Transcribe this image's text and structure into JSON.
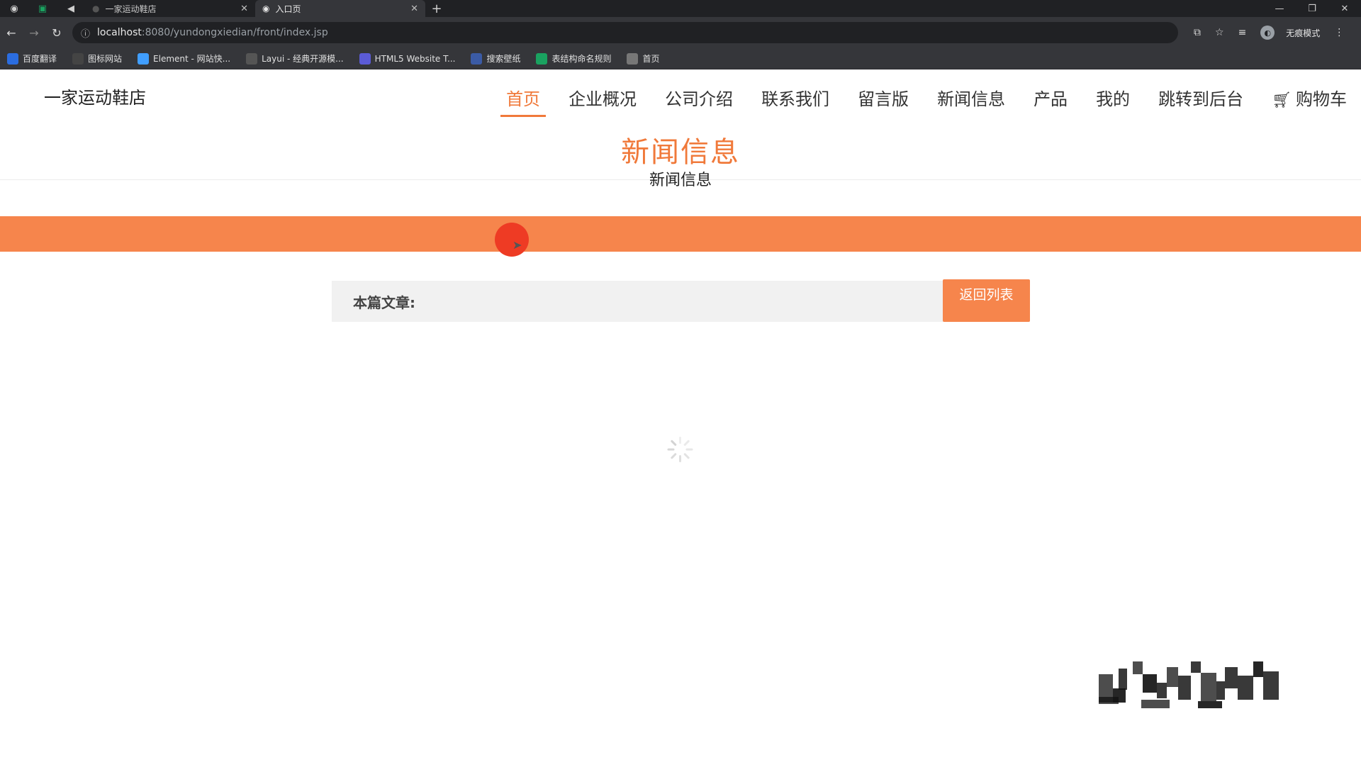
{
  "browser": {
    "tabs": [
      {
        "title": "一家运动鞋店",
        "close": "✕"
      },
      {
        "title": "入口页",
        "close": "✕"
      }
    ],
    "new_tab": "+",
    "window_controls": [
      "—",
      "❐",
      "✕"
    ],
    "url_host": "localhost",
    "url_path": ":8080/yundongxiedian/front/index.jsp",
    "profile_label": "无痕模式",
    "bookmarks": [
      {
        "label": "百度翻译",
        "icon": "translate-icon",
        "color": "#2b6de0"
      },
      {
        "label": "图标网站",
        "icon": "flag-icon",
        "color": "#444444"
      },
      {
        "label": "Element - 网站快...",
        "icon": "element-icon",
        "color": "#409eff"
      },
      {
        "label": "Layui - 经典开源模...",
        "icon": "layui-icon",
        "color": "#555555"
      },
      {
        "label": "HTML5 Website T...",
        "icon": "html5-icon",
        "color": "#5b5bd6"
      },
      {
        "label": "搜索壁纸",
        "icon": "wallpaper-icon",
        "color": "#3b5ba5"
      },
      {
        "label": "表结构命名规则",
        "icon": "doc-icon",
        "color": "#1aa260"
      },
      {
        "label": "首页",
        "icon": "globe-icon",
        "color": "#777777"
      }
    ]
  },
  "site": {
    "logo": "一家运动鞋店",
    "nav": [
      {
        "label": "首页",
        "active": true
      },
      {
        "label": "企业概况",
        "active": false
      },
      {
        "label": "公司介绍",
        "active": false
      },
      {
        "label": "联系我们",
        "active": false
      },
      {
        "label": "留言版",
        "active": false
      },
      {
        "label": "新闻信息",
        "active": false
      },
      {
        "label": "产品",
        "active": false
      },
      {
        "label": "我的",
        "active": false
      },
      {
        "label": "跳转到后台",
        "active": false
      }
    ],
    "cart_label": "购物车",
    "accent_color": "#f0793a"
  },
  "section": {
    "title": "新闻信息",
    "subtitle": "新闻信息"
  },
  "article": {
    "label": "本篇文章:",
    "back_button": "返回列表"
  }
}
